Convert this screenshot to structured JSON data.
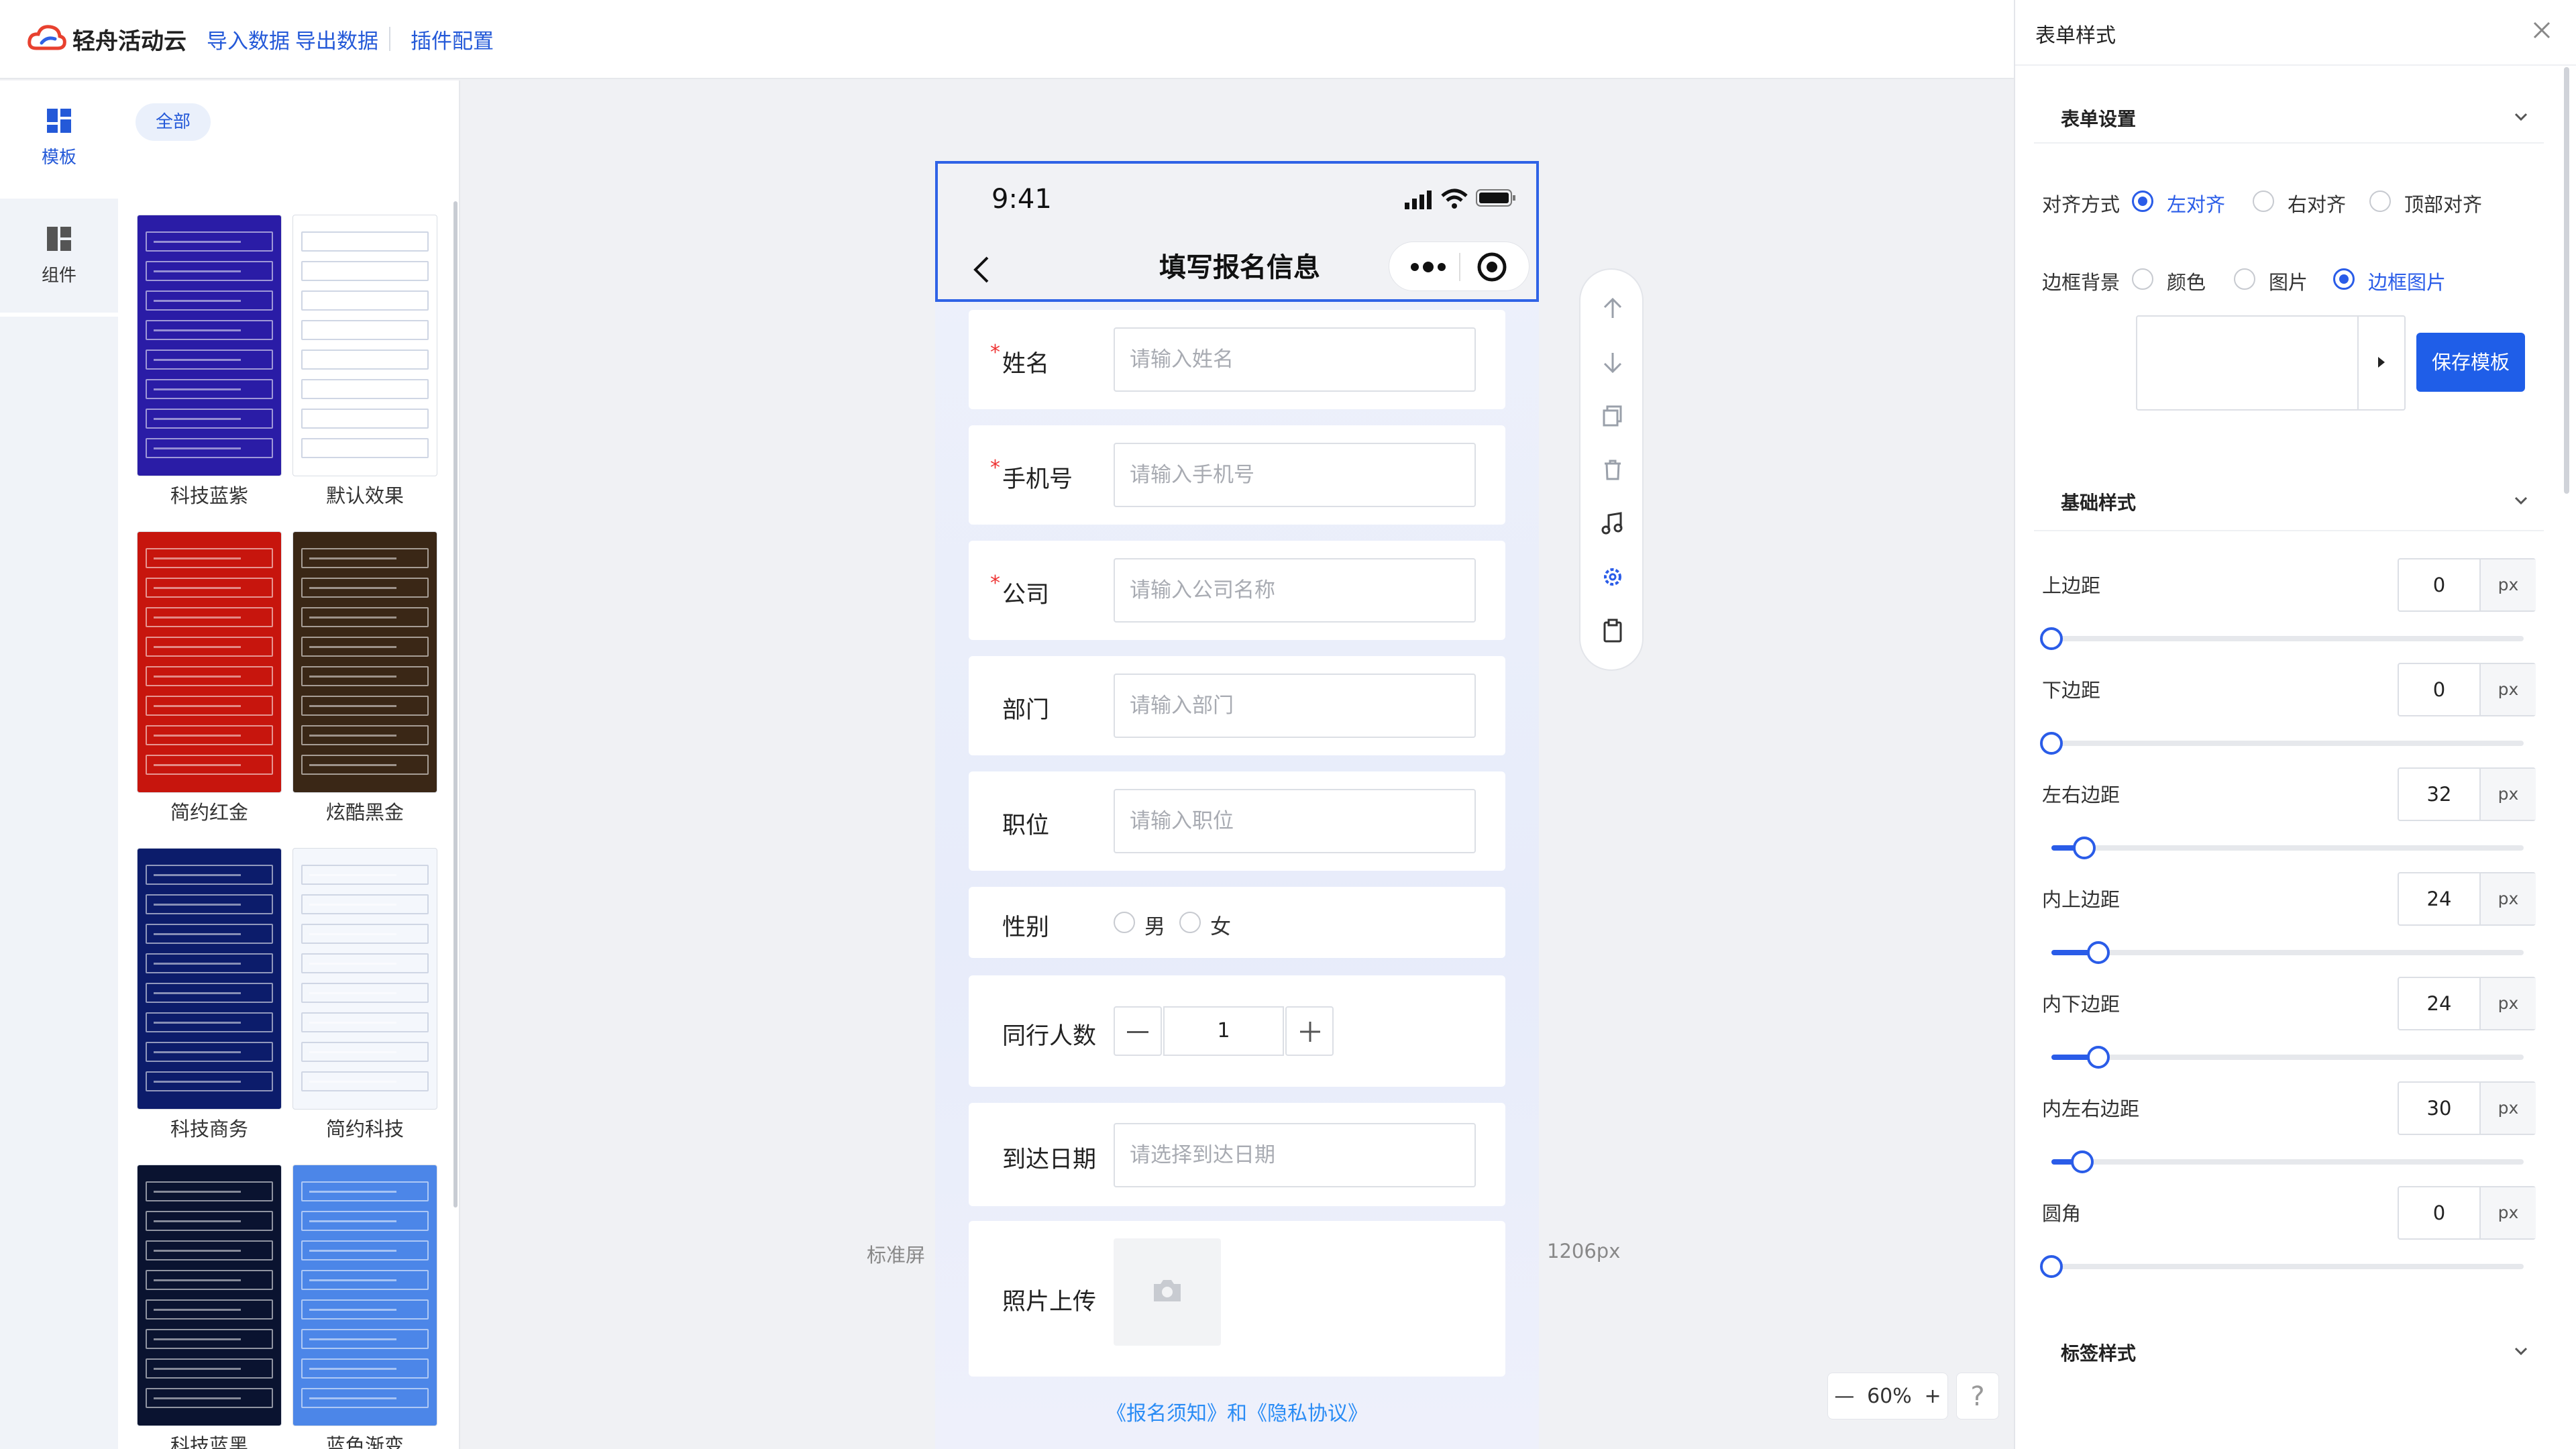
{
  "header": {
    "logo_text": "轻舟活动云",
    "nav": [
      "导入数据",
      "导出数据",
      "插件配置"
    ]
  },
  "rail": {
    "template_label": "模板",
    "component_label": "组件"
  },
  "templates": {
    "filter_all": "全部",
    "items": [
      {
        "name": "科技蓝紫",
        "bg": "#2a1ca6"
      },
      {
        "name": "默认效果",
        "bg": "#ffffff"
      },
      {
        "name": "简约红金",
        "bg": "#c7150d"
      },
      {
        "name": "炫酷黑金",
        "bg": "#3a2716"
      },
      {
        "name": "科技商务",
        "bg": "#0c1c6b"
      },
      {
        "name": "简约科技",
        "bg": "#f4f7fc"
      },
      {
        "name": "科技蓝黑",
        "bg": "#0a1330"
      },
      {
        "name": "蓝色渐变",
        "bg": "#4c86e8"
      }
    ]
  },
  "phone": {
    "time": "9:41",
    "title": "填写报名信息",
    "fields": [
      {
        "label": "姓名",
        "required": true,
        "placeholder": "请输入姓名"
      },
      {
        "label": "手机号",
        "required": true,
        "placeholder": "请输入手机号"
      },
      {
        "label": "公司",
        "required": true,
        "placeholder": "请输入公司名称"
      },
      {
        "label": "部门",
        "required": false,
        "placeholder": "请输入部门"
      },
      {
        "label": "职位",
        "required": false,
        "placeholder": "请输入职位"
      }
    ],
    "gender": {
      "label": "性别",
      "options": [
        "男",
        "女"
      ]
    },
    "companions": {
      "label": "同行人数",
      "value": "1"
    },
    "arrival": {
      "label": "到达日期",
      "placeholder": "请选择到达日期"
    },
    "photo": {
      "label": "照片上传"
    },
    "agreement": "《报名须知》和《隐私协议》"
  },
  "canvas": {
    "screen_label": "标准屏",
    "width_label": "1206px",
    "zoom": "60%",
    "help": "?"
  },
  "settings": {
    "title": "表单样式",
    "section_form": "表单设置",
    "align_label": "对齐方式",
    "align_options": [
      "左对齐",
      "右对齐",
      "顶部对齐"
    ],
    "border_bg_label": "边框背景",
    "border_bg_options": [
      "颜色",
      "图片",
      "边框图片"
    ],
    "save_template": "保存模板",
    "section_basic": "基础样式",
    "unit": "px",
    "params": [
      {
        "label": "上边距",
        "value": "0",
        "level": 0.0
      },
      {
        "label": "下边距",
        "value": "0",
        "level": 0.0
      },
      {
        "label": "左右边距",
        "value": "32",
        "level": 0.07
      },
      {
        "label": "内上边距",
        "value": "24",
        "level": 0.1
      },
      {
        "label": "内下边距",
        "value": "24",
        "level": 0.1
      },
      {
        "label": "内左右边距",
        "value": "30",
        "level": 0.065
      },
      {
        "label": "圆角",
        "value": "0",
        "level": 0.0
      }
    ],
    "section_label": "标签样式"
  }
}
